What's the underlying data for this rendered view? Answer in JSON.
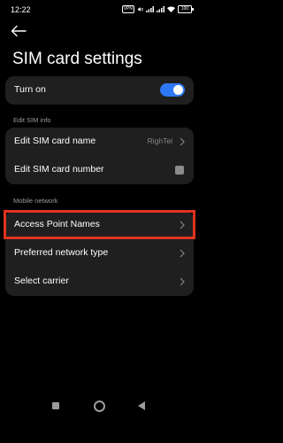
{
  "status_bar": {
    "time": "12:22",
    "indicators": [
      "dot-icon",
      "dot-icon",
      "dot-icon",
      "dot-icon"
    ],
    "right_icons": [
      "vpn-icon",
      "mute-icon",
      "volte-icon",
      "signal-icon",
      "wifi-icon"
    ],
    "vpn_label": "VPN",
    "battery_level": "100"
  },
  "header": {
    "back_icon": "arrow-left-icon",
    "title": "SIM card settings"
  },
  "turn_on": {
    "label": "Turn on",
    "enabled": true,
    "accent_color": "#2f78f5"
  },
  "edit_sim_section": {
    "heading": "Edit SIM info",
    "items": [
      {
        "label": "Edit SIM card name",
        "value": "RighTel"
      },
      {
        "label": "Edit SIM card number"
      }
    ]
  },
  "mobile_network_section": {
    "heading": "Mobile network",
    "items": [
      {
        "label": "Access Point Names"
      },
      {
        "label": "Preferred network type"
      },
      {
        "label": "Select carrier"
      }
    ]
  },
  "highlight_color": "#e03420",
  "nav_bar": {
    "icons": [
      "recents-icon",
      "home-icon",
      "back-icon"
    ]
  }
}
